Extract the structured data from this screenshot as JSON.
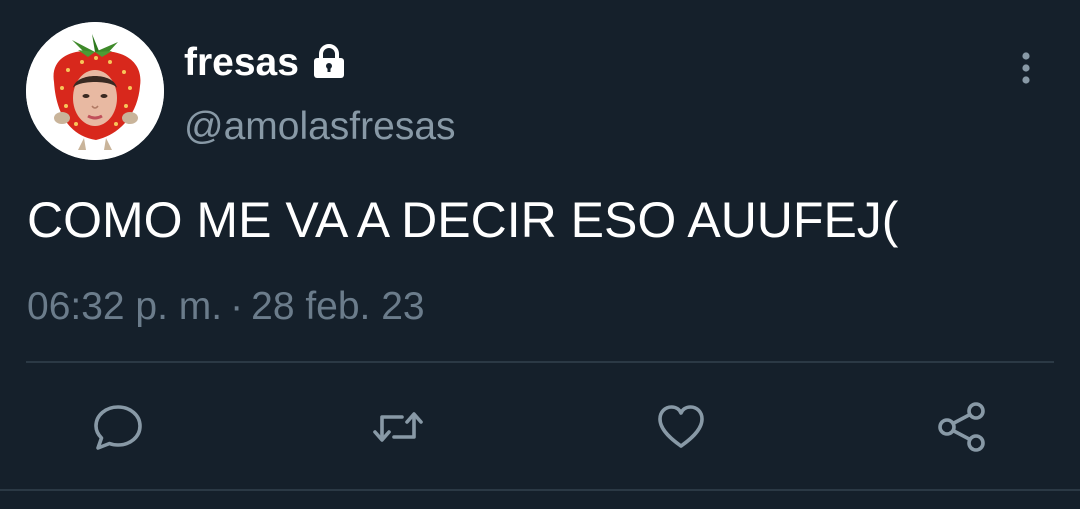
{
  "tweet": {
    "display_name": "fresas",
    "handle": "@amolasfresas",
    "text": "COMO ME VA A DECIR ESO AUUFEJ(",
    "time": "06:32 p. m.",
    "separator": "·",
    "date": "28 feb. 23",
    "protected_icon": "lock-icon",
    "avatar_icon": "strawberry-avatar"
  },
  "actions": [
    {
      "name": "reply",
      "icon": "reply-icon"
    },
    {
      "name": "retweet",
      "icon": "retweet-icon"
    },
    {
      "name": "like",
      "icon": "heart-icon"
    },
    {
      "name": "share",
      "icon": "share-icon"
    }
  ],
  "colors": {
    "background": "#15202b",
    "primary_text": "#ffffff",
    "secondary_text": "#8899a6",
    "icon": "#8899a6",
    "divider": "#2b3945"
  }
}
